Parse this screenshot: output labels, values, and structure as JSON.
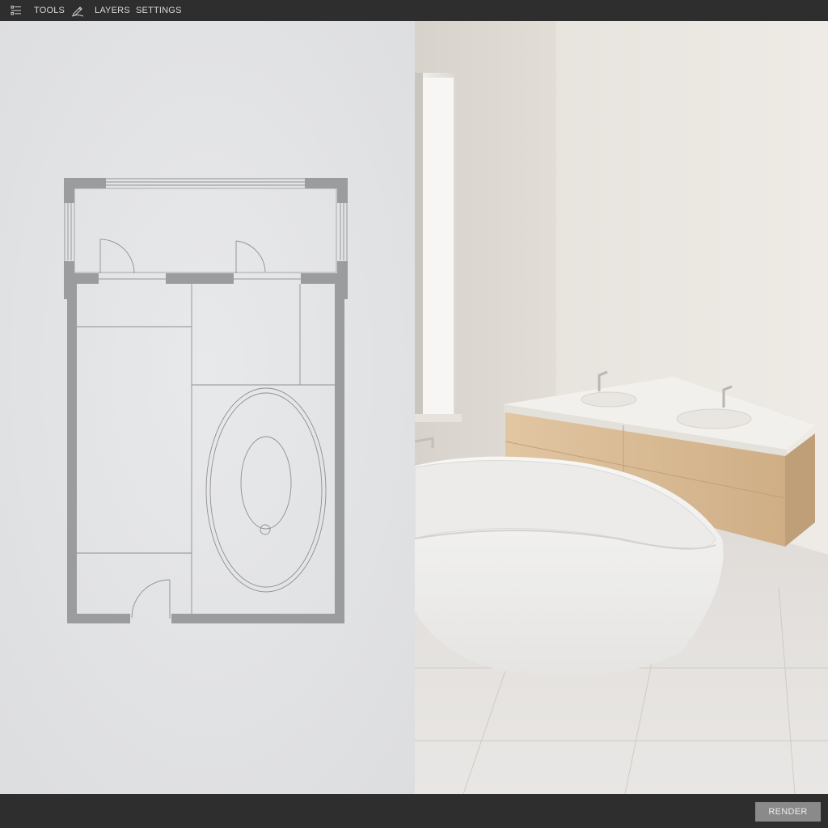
{
  "toolbar": {
    "items": [
      {
        "label": "TOOLS",
        "icon": "tools-list-icon"
      },
      {
        "label": "LAYERS",
        "icon": "pencil-icon"
      },
      {
        "label": "SETTINGS",
        "icon": ""
      }
    ]
  },
  "footer": {
    "render_label": "RENDER"
  },
  "colors": {
    "chrome": "#2e2e2e",
    "plan_background": "#e3e4e5",
    "plan_wall": "#9b9c9d",
    "render_button": "#8a8a8a",
    "vanity_wood": "#d9bc96"
  }
}
